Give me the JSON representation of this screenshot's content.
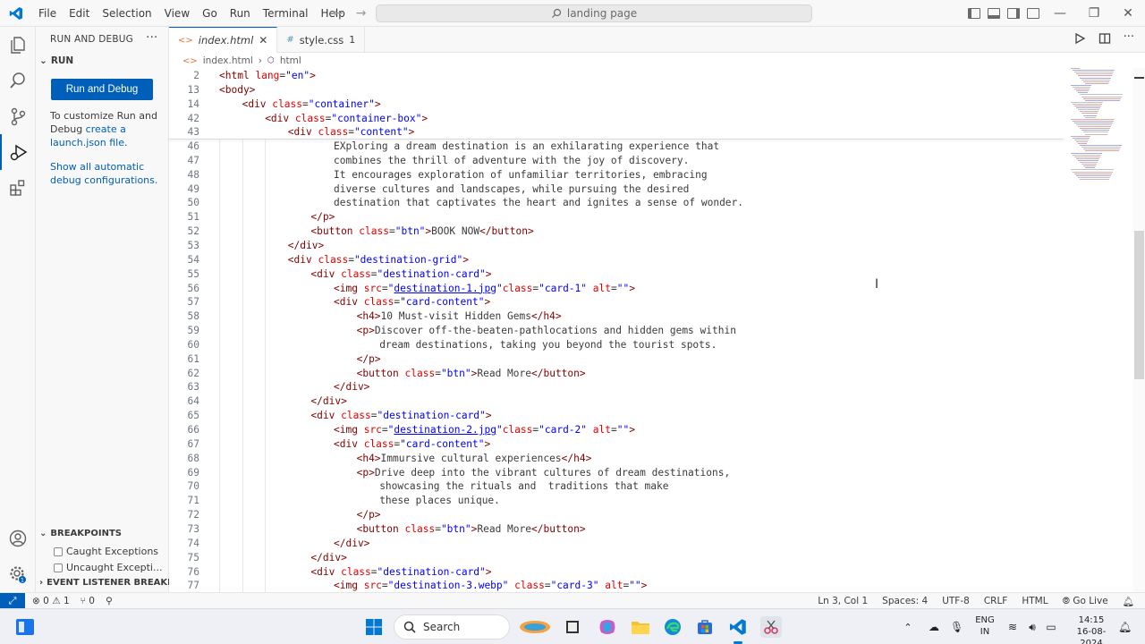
{
  "titlebar": {
    "menu": [
      "File",
      "Edit",
      "Selection",
      "View",
      "Go",
      "Run",
      "Terminal",
      "Help"
    ],
    "command_center": "landing page"
  },
  "sidebar": {
    "title": "RUN AND DEBUG",
    "run_section": "RUN",
    "run_button": "Run and Debug",
    "customize_text_1": "To customize Run and Debug ",
    "customize_link": "create a launch.json file",
    "customize_text_2": ".",
    "show_all_link": "Show all automatic debug configurations.",
    "breakpoints_title": "BREAKPOINTS",
    "breakpoints": [
      "Caught Exceptions",
      "Uncaught Excepti..."
    ],
    "event_listener_title": "EVENT LISTENER BREAKPOI..."
  },
  "tabs": [
    {
      "label": "index.html",
      "active": true
    },
    {
      "label": "style.css",
      "badge": "1",
      "active": false
    }
  ],
  "breadcrumb": [
    "index.html",
    "html"
  ],
  "editor": {
    "sticky": [
      {
        "n": "2",
        "indent": 0,
        "html": "<span class='t-tag'>&lt;html</span> <span class='t-attr'>lang</span>=<span class='t-val'>\"en\"</span><span class='t-tag'>&gt;</span>"
      },
      {
        "n": "13",
        "indent": 0,
        "html": "<span class='t-tag'>&lt;body&gt;</span>"
      },
      {
        "n": "14",
        "indent": 1,
        "html": "<span class='t-tag'>&lt;div</span> <span class='t-attr'>class</span>=<span class='t-val'>\"container\"</span><span class='t-tag'>&gt;</span>"
      },
      {
        "n": "42",
        "indent": 2,
        "html": "<span class='t-tag'>&lt;div</span> <span class='t-attr'>class</span>=<span class='t-val'>\"container-box\"</span><span class='t-tag'>&gt;</span>"
      },
      {
        "n": "43",
        "indent": 3,
        "html": "<span class='t-tag'>&lt;div</span> <span class='t-attr'>class</span>=<span class='t-val'>\"content\"</span><span class='t-tag'>&gt;</span>"
      }
    ],
    "lines": [
      {
        "n": "46",
        "indent": 5,
        "html": "<span class='t-txt'>EXploring a dream destination is an exhilarating experience that</span>"
      },
      {
        "n": "47",
        "indent": 5,
        "html": "<span class='t-txt'>combines the thrill of adventure with the joy of discovery.</span>"
      },
      {
        "n": "48",
        "indent": 5,
        "html": "<span class='t-txt'>It encourages exploration of unfamiliar territories, embracing</span>"
      },
      {
        "n": "49",
        "indent": 5,
        "html": "<span class='t-txt'>diverse cultures and landscapes, while pursuing the desired</span>"
      },
      {
        "n": "50",
        "indent": 5,
        "html": "<span class='t-txt'>destination that captivates the heart and ignites a sense of wonder.</span>"
      },
      {
        "n": "51",
        "indent": 4,
        "html": "<span class='t-tag'>&lt;/p&gt;</span>"
      },
      {
        "n": "52",
        "indent": 4,
        "html": "<span class='t-tag'>&lt;button</span> <span class='t-attr'>class</span>=<span class='t-val'>\"btn\"</span><span class='t-tag'>&gt;</span><span class='t-txt'>BOOK NOW</span><span class='t-tag'>&lt;/button&gt;</span>"
      },
      {
        "n": "53",
        "indent": 3,
        "html": "<span class='t-tag'>&lt;/div&gt;</span>"
      },
      {
        "n": "54",
        "indent": 3,
        "html": "<span class='t-tag'>&lt;div</span> <span class='t-attr'>class</span>=<span class='t-val'>\"destination-grid\"</span><span class='t-tag'>&gt;</span>"
      },
      {
        "n": "55",
        "indent": 4,
        "html": "<span class='t-tag'>&lt;div</span> <span class='t-attr'>class</span>=<span class='t-val'>\"destination-card\"</span><span class='t-tag'>&gt;</span>"
      },
      {
        "n": "56",
        "indent": 5,
        "html": "<span class='t-tag'>&lt;img</span> <span class='t-attr'>src</span>=<span class='t-val'>\"</span><span class='t-link'>destination-1.jpg</span><span class='t-val'>\"</span><span class='t-attr'>class</span>=<span class='t-val'>\"card-1\"</span> <span class='t-attr'>alt</span>=<span class='t-val'>\"\"</span><span class='t-tag'>&gt;</span>"
      },
      {
        "n": "57",
        "indent": 5,
        "html": "<span class='t-tag'>&lt;div</span> <span class='t-attr'>class</span>=<span class='t-val'>\"card-content\"</span><span class='t-tag'>&gt;</span>"
      },
      {
        "n": "58",
        "indent": 6,
        "html": "<span class='t-tag'>&lt;h4&gt;</span><span class='t-txt'>10 Must-visit Hidden Gems</span><span class='t-tag'>&lt;/h4&gt;</span>"
      },
      {
        "n": "59",
        "indent": 6,
        "html": "<span class='t-tag'>&lt;p&gt;</span><span class='t-txt'>Discover off-the-beaten-pathlocations and hidden gems within</span>"
      },
      {
        "n": "60",
        "indent": 7,
        "html": "<span class='t-txt'>dream destinations, taking you beyond the tourist spots.</span>"
      },
      {
        "n": "61",
        "indent": 6,
        "html": "<span class='t-tag'>&lt;/p&gt;</span>"
      },
      {
        "n": "62",
        "indent": 6,
        "html": "<span class='t-tag'>&lt;button</span> <span class='t-attr'>class</span>=<span class='t-val'>\"btn\"</span><span class='t-tag'>&gt;</span><span class='t-txt'>Read More</span><span class='t-tag'>&lt;/button&gt;</span>"
      },
      {
        "n": "63",
        "indent": 5,
        "html": "<span class='t-tag'>&lt;/div&gt;</span>"
      },
      {
        "n": "64",
        "indent": 4,
        "html": "<span class='t-tag'>&lt;/div&gt;</span>"
      },
      {
        "n": "65",
        "indent": 4,
        "html": "<span class='t-tag'>&lt;div</span> <span class='t-attr'>class</span>=<span class='t-val'>\"destination-card\"</span><span class='t-tag'>&gt;</span>"
      },
      {
        "n": "66",
        "indent": 5,
        "html": "<span class='t-tag'>&lt;img</span> <span class='t-attr'>src</span>=<span class='t-val'>\"</span><span class='t-link'>destination-2.jpg</span><span class='t-val'>\"</span><span class='t-attr'>class</span>=<span class='t-val'>\"card-2\"</span> <span class='t-attr'>alt</span>=<span class='t-val'>\"\"</span><span class='t-tag'>&gt;</span>"
      },
      {
        "n": "67",
        "indent": 5,
        "html": "<span class='t-tag'>&lt;div</span> <span class='t-attr'>class</span>=<span class='t-val'>\"card-content\"</span><span class='t-tag'>&gt;</span>"
      },
      {
        "n": "68",
        "indent": 6,
        "html": "<span class='t-tag'>&lt;h4&gt;</span><span class='t-txt'>Immursive cultural experiences</span><span class='t-tag'>&lt;/h4&gt;</span>"
      },
      {
        "n": "69",
        "indent": 6,
        "html": "<span class='t-tag'>&lt;p&gt;</span><span class='t-txt'>Drive deep into the vibrant cultures of dream destinations,</span>"
      },
      {
        "n": "70",
        "indent": 7,
        "html": "<span class='t-txt'>showcasing the rituals and  traditions that make</span>"
      },
      {
        "n": "71",
        "indent": 7,
        "html": "<span class='t-txt'>these places unique.</span>"
      },
      {
        "n": "72",
        "indent": 6,
        "html": "<span class='t-tag'>&lt;/p&gt;</span>"
      },
      {
        "n": "73",
        "indent": 6,
        "html": "<span class='t-tag'>&lt;button</span> <span class='t-attr'>class</span>=<span class='t-val'>\"btn\"</span><span class='t-tag'>&gt;</span><span class='t-txt'>Read More</span><span class='t-tag'>&lt;/button&gt;</span>"
      },
      {
        "n": "74",
        "indent": 5,
        "html": "<span class='t-tag'>&lt;/div&gt;</span>"
      },
      {
        "n": "75",
        "indent": 4,
        "html": "<span class='t-tag'>&lt;/div&gt;</span>"
      },
      {
        "n": "76",
        "indent": 4,
        "html": "<span class='t-tag'>&lt;div</span> <span class='t-attr'>class</span>=<span class='t-val'>\"destination-card\"</span><span class='t-tag'>&gt;</span>"
      },
      {
        "n": "77",
        "indent": 5,
        "html": "<span class='t-tag'>&lt;img</span> <span class='t-attr'>src</span>=<span class='t-val'>\"destination-3.webp\"</span> <span class='t-attr'>class</span>=<span class='t-val'>\"card-3\"</span> <span class='t-attr'>alt</span>=<span class='t-val'>\"\"</span><span class='t-tag'>&gt;</span>"
      }
    ]
  },
  "statusbar": {
    "errors": "0",
    "warnings": "1",
    "ports": "0",
    "position": "Ln 3, Col 1",
    "spaces": "Spaces: 4",
    "encoding": "UTF-8",
    "eol": "CRLF",
    "language": "HTML",
    "go_live": "Go Live"
  },
  "taskbar": {
    "search": "Search",
    "lang_1": "ENG",
    "lang_2": "IN",
    "time": "14:15",
    "date": "16-08-2024"
  },
  "colors": {
    "accent": "#005fb8",
    "tag": "#800000",
    "attribute": "#e50000",
    "value": "#0000ff"
  }
}
